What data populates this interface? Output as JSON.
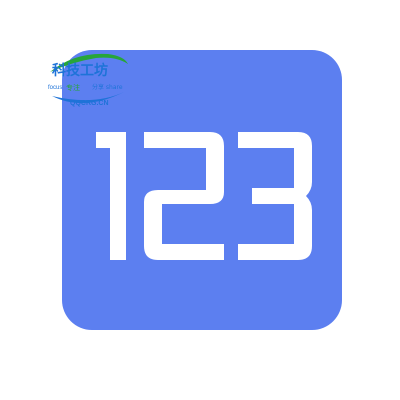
{
  "app": {
    "name": "123",
    "brand_color": "#5c7ff0",
    "glyph_color": "#ffffff"
  },
  "watermark": {
    "title": "科技工坊",
    "left_caption": "focus",
    "middle_caption": "专注",
    "right_caption": "分享 share",
    "domain": "QQCRG.CN",
    "title_color": "#1e73d8",
    "accent_color": "#27a53a"
  }
}
